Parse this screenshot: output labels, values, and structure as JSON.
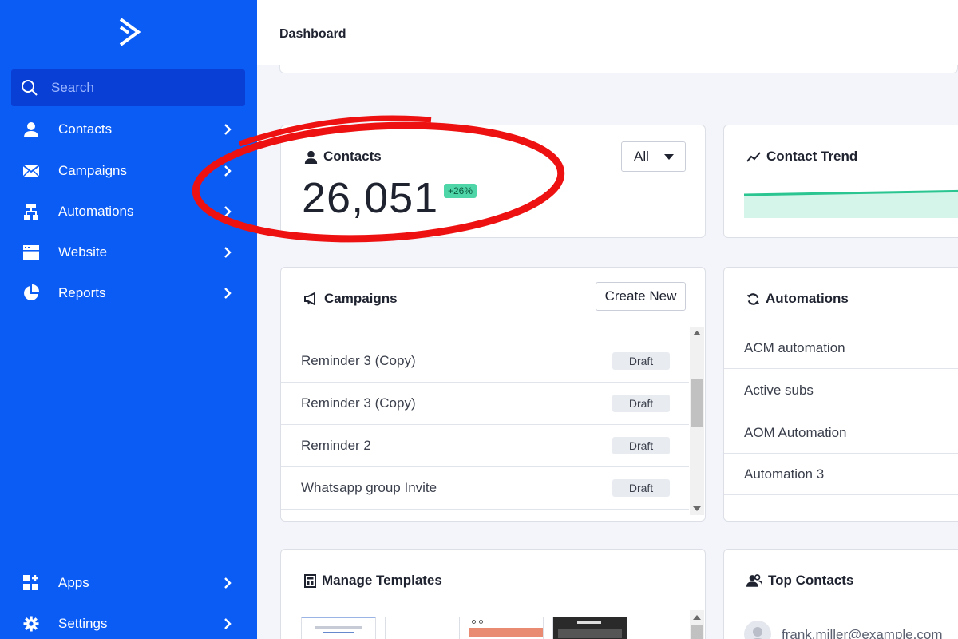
{
  "sidebar": {
    "search": {
      "placeholder": "Search"
    },
    "items": [
      {
        "label": "Contacts",
        "icon": "person-icon"
      },
      {
        "label": "Campaigns",
        "icon": "envelope-icon"
      },
      {
        "label": "Automations",
        "icon": "sitemap-icon"
      },
      {
        "label": "Website",
        "icon": "browser-window-icon"
      },
      {
        "label": "Reports",
        "icon": "pie-chart-icon"
      }
    ],
    "bottom_items": [
      {
        "label": "Apps",
        "icon": "apps-grid-icon"
      },
      {
        "label": "Settings",
        "icon": "gear-icon"
      }
    ],
    "colors": {
      "background": "#0b5cf5",
      "search_bg": "#0a3fd6"
    }
  },
  "header": {
    "title": "Dashboard"
  },
  "contacts_card": {
    "title": "Contacts",
    "count": "26,051",
    "change": "+26%",
    "filter": {
      "selected": "All"
    }
  },
  "trend_card": {
    "title": "Contact Trend",
    "line_color": "#2bc592",
    "fill_color": "#d6f5ea"
  },
  "campaigns_card": {
    "title": "Campaigns",
    "create_label": "Create New",
    "rows": [
      {
        "name": "Reminder 3 (Copy)",
        "status": "Draft"
      },
      {
        "name": "Reminder 3 (Copy)",
        "status": "Draft"
      },
      {
        "name": "Reminder 2",
        "status": "Draft"
      },
      {
        "name": "Whatsapp group Invite",
        "status": "Draft"
      }
    ]
  },
  "automations_card": {
    "title": "Automations",
    "rows": [
      "ACM automation",
      "Active subs",
      "AOM Automation",
      "Automation 3"
    ]
  },
  "templates_card": {
    "title": "Manage Templates"
  },
  "top_contacts_card": {
    "title": "Top Contacts",
    "first_email": "frank.miller@example.com"
  },
  "annotation": {
    "color": "#ee1111"
  }
}
